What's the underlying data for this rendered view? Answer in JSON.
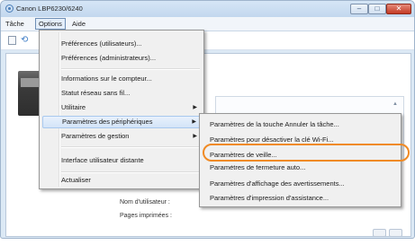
{
  "window": {
    "title": "Canon LBP6230/6240",
    "controls": {
      "minimize": "–",
      "maximize": "□",
      "close": "✕"
    }
  },
  "menubar": {
    "items": [
      {
        "label": "Tâche"
      },
      {
        "label": "Options"
      },
      {
        "label": "Aide"
      }
    ]
  },
  "options_menu": {
    "items": [
      {
        "label": "Préférences (utilisateurs)..."
      },
      {
        "label": "Préférences (administrateurs)..."
      },
      {
        "label": "Informations sur le compteur..."
      },
      {
        "label": "Statut réseau sans fil..."
      },
      {
        "label": "Utilitaire"
      },
      {
        "label": "Paramètres des périphériques"
      },
      {
        "label": "Paramètres de gestion"
      },
      {
        "label": "Interface utilisateur distante"
      },
      {
        "label": "Actualiser"
      }
    ]
  },
  "device_submenu": {
    "items": [
      {
        "label": "Paramètres de la touche Annuler la tâche..."
      },
      {
        "label": "Paramètres pour désactiver la clé Wi-Fi..."
      },
      {
        "label": "Paramètres de veille..."
      },
      {
        "label": "Paramètres de fermeture auto..."
      },
      {
        "label": "Paramètres d'affichage des avertissements..."
      },
      {
        "label": "Paramètres d'impression d'assistance..."
      }
    ]
  },
  "info": {
    "user_label": "Nom d'utilisateur :",
    "pages_label": "Pages imprimées :"
  },
  "colors": {
    "highlight_callout": "#f08a24",
    "close_button": "#c43a24"
  }
}
